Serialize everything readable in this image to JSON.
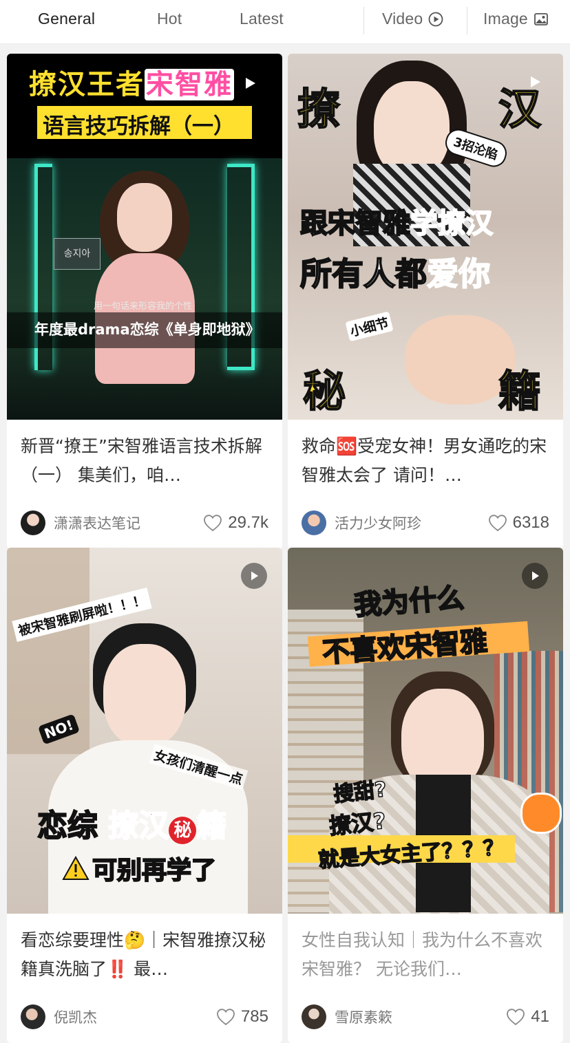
{
  "tabs": [
    {
      "label": "General",
      "active": true
    },
    {
      "label": "Hot",
      "active": false
    },
    {
      "label": "Latest",
      "active": false
    },
    {
      "label": "Video",
      "active": false,
      "icon": "play-circle-icon"
    },
    {
      "label": "Image",
      "active": false,
      "icon": "image-icon"
    }
  ],
  "colors": {
    "accent_red": "#ff2442",
    "heart_outline": "#999999",
    "yellow": "#ffe02e"
  },
  "cards": [
    {
      "thumb_text": {
        "line1": "撩汉王者",
        "line1_highlight": "宋智雅",
        "line2": "语言技巧拆解（一）",
        "name_tag": "송지아",
        "subtitle": "用一句话来形容我的个性",
        "caption": "年度最drama恋综《单身即地狱》"
      },
      "title": "新晋“撩王”宋智雅语言技术拆解（一） 集美们，咱…",
      "author": "潇潇表达笔记",
      "likes": "29.7k",
      "title_muted": false
    },
    {
      "thumb_text": {
        "corner_left": "撩",
        "corner_right": "汉",
        "sticker": "3招沦陷",
        "line1": "跟宋智雅",
        "line1_highlight": "学撩汉",
        "line2": "所有人都",
        "line2_highlight": "爱你",
        "small": "小细节",
        "bottom_left": "秘",
        "bottom_right": "籍"
      },
      "title": "救命🆘受宠女神！男女通吃的宋智雅太会了 请问！…",
      "author": "活力少女阿珍",
      "likes": "6318",
      "title_muted": false
    },
    {
      "thumb_text": {
        "top": "被宋智雅刷屏啦！！！",
        "no": "NO!",
        "side": "女孩们清醒一点",
        "main_a": "恋综",
        "main_b": "撩汉",
        "main_c": "秘",
        "main_d": "籍",
        "warn": "可别再学了"
      },
      "title": "看恋综要理性🤔｜宋智雅撩汉秘籍真洗脑了‼️ 最…",
      "author": "倪凯杰",
      "likes": "785",
      "title_muted": false
    },
    {
      "thumb_text": {
        "line1": "我为什么",
        "line2": "不喜欢宋智雅",
        "q1": "搜甜?",
        "q2": "撩汉?",
        "q3": "就是大女主了？？？"
      },
      "title": "女性自我认知｜我为什么不喜欢宋智雅？ 无论我们…",
      "author": "雪原素簌",
      "likes": "41",
      "title_muted": true
    }
  ]
}
